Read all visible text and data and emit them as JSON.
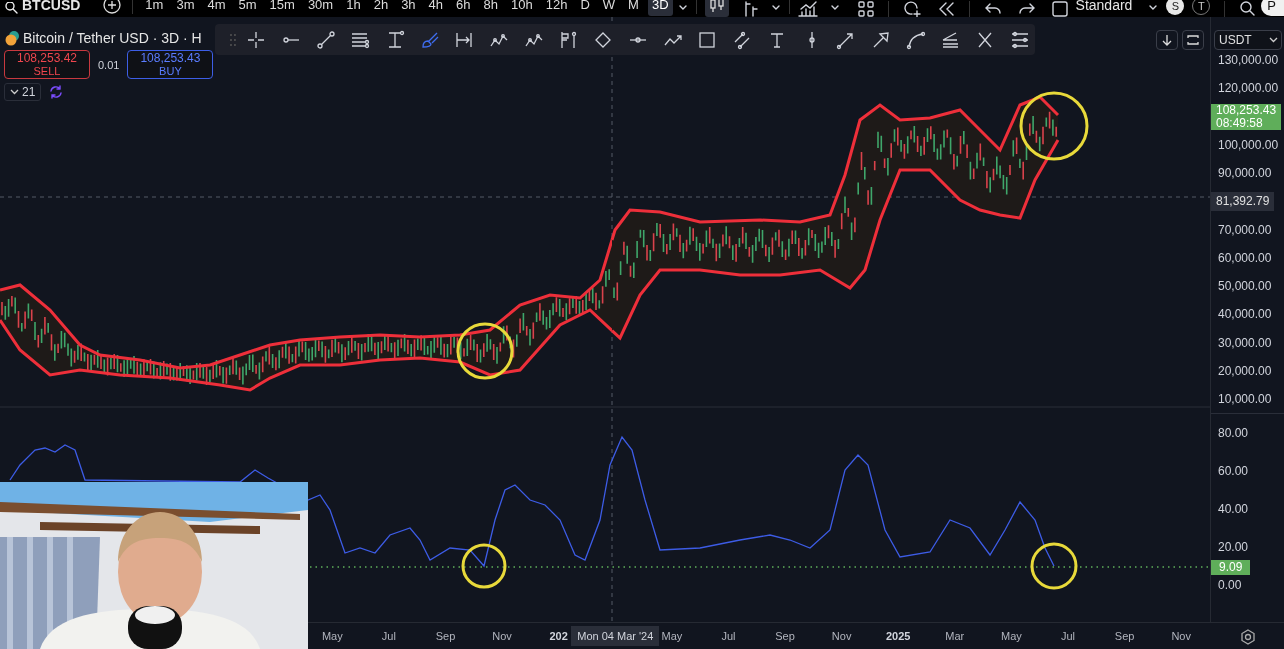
{
  "top_bar": {
    "symbol": "BTCUSD",
    "intervals": [
      {
        "label": "1m",
        "selected": false
      },
      {
        "label": "3m",
        "selected": false
      },
      {
        "label": "4m",
        "selected": false
      },
      {
        "label": "5m",
        "selected": false
      },
      {
        "label": "15m",
        "selected": false
      },
      {
        "label": "30m",
        "selected": false
      },
      {
        "label": "1h",
        "selected": false
      },
      {
        "label": "2h",
        "selected": false
      },
      {
        "label": "3h",
        "selected": false
      },
      {
        "label": "4h",
        "selected": false
      },
      {
        "label": "6h",
        "selected": false
      },
      {
        "label": "8h",
        "selected": false
      },
      {
        "label": "10h",
        "selected": false
      },
      {
        "label": "12h",
        "selected": false
      },
      {
        "label": "D",
        "selected": false
      },
      {
        "label": "W",
        "selected": false
      },
      {
        "label": "M",
        "selected": false
      },
      {
        "label": "3D",
        "selected": true
      }
    ],
    "candles_button": {
      "selected": true
    },
    "layout_name": "Standard",
    "avatars": [
      {
        "label": "S",
        "kind": "filled"
      },
      {
        "label": "T",
        "kind": "outline"
      }
    ],
    "profile": "P"
  },
  "legend": {
    "title": "Bitcoin / Tether USD · 3D · H",
    "sell": {
      "price": "108,253.42",
      "label": "SELL"
    },
    "spread": "0.01",
    "buy": {
      "price": "108,253.43",
      "label": "BUY"
    },
    "indicators_count": "21"
  },
  "drawing_toolbar": {
    "tools": [
      {
        "selected": false
      },
      {
        "selected": false
      },
      {
        "selected": false
      },
      {
        "selected": false
      },
      {
        "selected": false
      },
      {
        "selected": true
      },
      {
        "selected": false
      },
      {
        "selected": false
      },
      {
        "selected": false
      },
      {
        "selected": false
      },
      {
        "selected": false
      },
      {
        "selected": false
      },
      {
        "selected": false
      },
      {
        "selected": false
      },
      {
        "selected": false
      },
      {
        "selected": false
      },
      {
        "selected": false
      },
      {
        "selected": false
      },
      {
        "selected": false
      },
      {
        "selected": false
      },
      {
        "selected": false
      },
      {
        "selected": false
      },
      {
        "selected": false
      }
    ]
  },
  "currency": "USDT",
  "price_axis": {
    "items": [
      {
        "kind": "label",
        "text": "130,000.00"
      },
      {
        "kind": "label",
        "text": "120,000.00"
      },
      {
        "kind": "price_tag",
        "price": "108,253.43",
        "countdown": "08:49:58"
      },
      {
        "kind": "label",
        "text": "100,000.00"
      },
      {
        "kind": "label",
        "text": "90,000.00"
      },
      {
        "kind": "crosshair_tag",
        "text": "81,392.79"
      },
      {
        "kind": "label",
        "text": "70,000.00"
      },
      {
        "kind": "label",
        "text": "60,000.00"
      },
      {
        "kind": "label",
        "text": "50,000.00"
      },
      {
        "kind": "label",
        "text": "40,000.00"
      },
      {
        "kind": "label",
        "text": "30,000.00"
      },
      {
        "kind": "label",
        "text": "20,000.00"
      },
      {
        "kind": "label",
        "text": "10,000.00"
      }
    ]
  },
  "indicator_axis": {
    "labels": [
      "80.00",
      "60.00",
      "40.00",
      "20.00",
      "0.00"
    ],
    "value_tag": "9.09"
  },
  "time_axis": {
    "labels": [
      {
        "text": "May",
        "kind": "month"
      },
      {
        "text": "Jul",
        "kind": "month"
      },
      {
        "text": "Sep",
        "kind": "month"
      },
      {
        "text": "Nov",
        "kind": "month"
      },
      {
        "text": "202",
        "kind": "year"
      },
      {
        "text": "Mon 04 Mar '24",
        "kind": "crosshair"
      },
      {
        "text": "May",
        "kind": "month"
      },
      {
        "text": "Jul",
        "kind": "month"
      },
      {
        "text": "Sep",
        "kind": "month"
      },
      {
        "text": "Nov",
        "kind": "month"
      },
      {
        "text": "2025",
        "kind": "year"
      },
      {
        "text": "Mar",
        "kind": "month"
      },
      {
        "text": "May",
        "kind": "month"
      },
      {
        "text": "Jul",
        "kind": "month"
      },
      {
        "text": "Sep",
        "kind": "month"
      },
      {
        "text": "Nov",
        "kind": "month"
      }
    ]
  }
}
